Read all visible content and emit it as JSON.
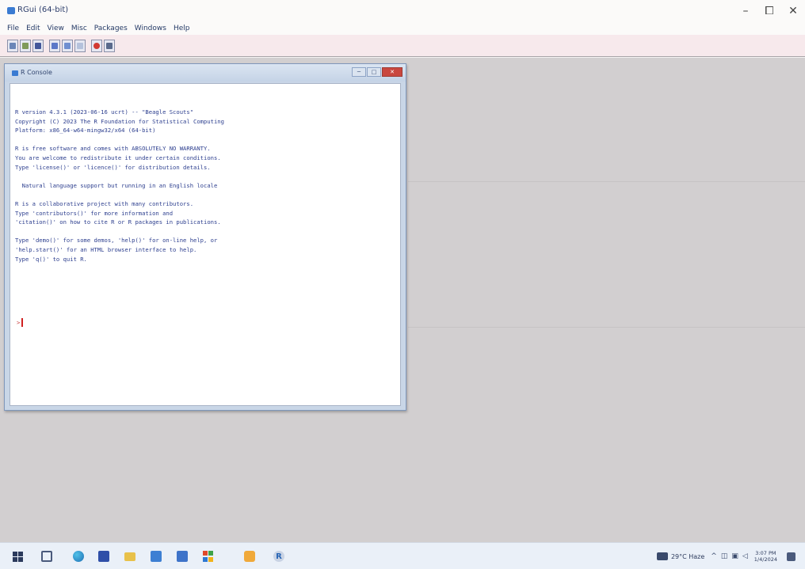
{
  "window": {
    "title": "RGui (64-bit)",
    "controls": {
      "minimize": "–",
      "maximize": "⧠",
      "close": "✕"
    }
  },
  "menubar": {
    "items": [
      "File",
      "Edit",
      "View",
      "Misc",
      "Packages",
      "Windows",
      "Help"
    ]
  },
  "toolbar": {
    "buttons": [
      {
        "name": "open-script",
        "color": "#6a86b8"
      },
      {
        "name": "load-workspace",
        "color": "#7f9a5a"
      },
      {
        "name": "save-workspace",
        "color": "#43579a"
      },
      {
        "name": "copy",
        "color": "#5b78c8"
      },
      {
        "name": "paste",
        "color": "#6f8fd0"
      },
      {
        "name": "copy-paste",
        "color": "#b5c2dc"
      },
      {
        "name": "stop",
        "color": "#d23a32"
      },
      {
        "name": "print",
        "color": "#5a6a8c"
      }
    ]
  },
  "console": {
    "title": "R Console",
    "controls": {
      "minimize": "─",
      "maximize": "□",
      "close": "✕"
    },
    "lines": [
      "R version 4.3.1 (2023-06-16 ucrt) -- \"Beagle Scouts\"",
      "Copyright (C) 2023 The R Foundation for Statistical Computing",
      "Platform: x86_64-w64-mingw32/x64 (64-bit)",
      "",
      "R is free software and comes with ABSOLUTELY NO WARRANTY.",
      "You are welcome to redistribute it under certain conditions.",
      "Type 'license()' or 'licence()' for distribution details.",
      "",
      "  Natural language support but running in an English locale",
      "",
      "R is a collaborative project with many contributors.",
      "Type 'contributors()' for more information and",
      "'citation()' on how to cite R or R packages in publications.",
      "",
      "Type 'demo()' for some demos, 'help()' for on-line help, or",
      "'help.start()' for an HTML browser interface to help.",
      "Type 'q()' to quit R."
    ],
    "prompt": ">"
  },
  "taskbar": {
    "pinned": [
      "start",
      "task-view",
      "edge",
      "store",
      "file-explorer",
      "mail",
      "photos",
      "office",
      "files",
      "r"
    ],
    "tray": {
      "weather": "29°C Haze",
      "chevron": "^",
      "time": "3:07 PM",
      "date": "1/4/2024"
    }
  }
}
